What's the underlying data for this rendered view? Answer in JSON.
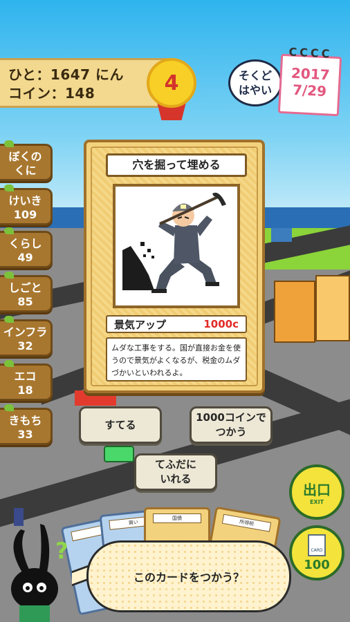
{
  "status": {
    "population_label": "ひと：1647 にん",
    "coins_label": "コイン：148",
    "level": "4"
  },
  "speed_button": {
    "line1": "そくど",
    "line2": "はやい"
  },
  "calendar": {
    "year": "2017",
    "date": "7/29",
    "rings": "CCCC"
  },
  "side_tabs": [
    {
      "line1": "ぼくの",
      "line2": "くに"
    },
    {
      "line1": "けいき",
      "line2": "109"
    },
    {
      "line1": "くらし",
      "line2": "49"
    },
    {
      "line1": "しごと",
      "line2": "85"
    },
    {
      "line1": "インフラ",
      "line2": "32"
    },
    {
      "line1": "エコ",
      "line2": "18"
    },
    {
      "line1": "きもち",
      "line2": "33"
    }
  ],
  "card": {
    "title": "穴を掘って埋める",
    "effect_label": "景気アップ",
    "cost": "1000c",
    "description": "ムダな工事をする。国が直接お金を使うので景気がよくなるが、税金のムダづかいといわれるよ。"
  },
  "actions": {
    "discard": "すてる",
    "use_coins_line1": "1000コインで",
    "use_coins_line2": "つかう",
    "keep_line1": "てふだに",
    "keep_line2": "いれる"
  },
  "exit_button": {
    "main": "出口",
    "sub": "EXIT"
  },
  "cards_button": {
    "count": "100",
    "icon_label": "CARD"
  },
  "hand_cards": [
    "国債",
    "所得税",
    "買い"
  ],
  "message": "このカードをつかう？"
}
